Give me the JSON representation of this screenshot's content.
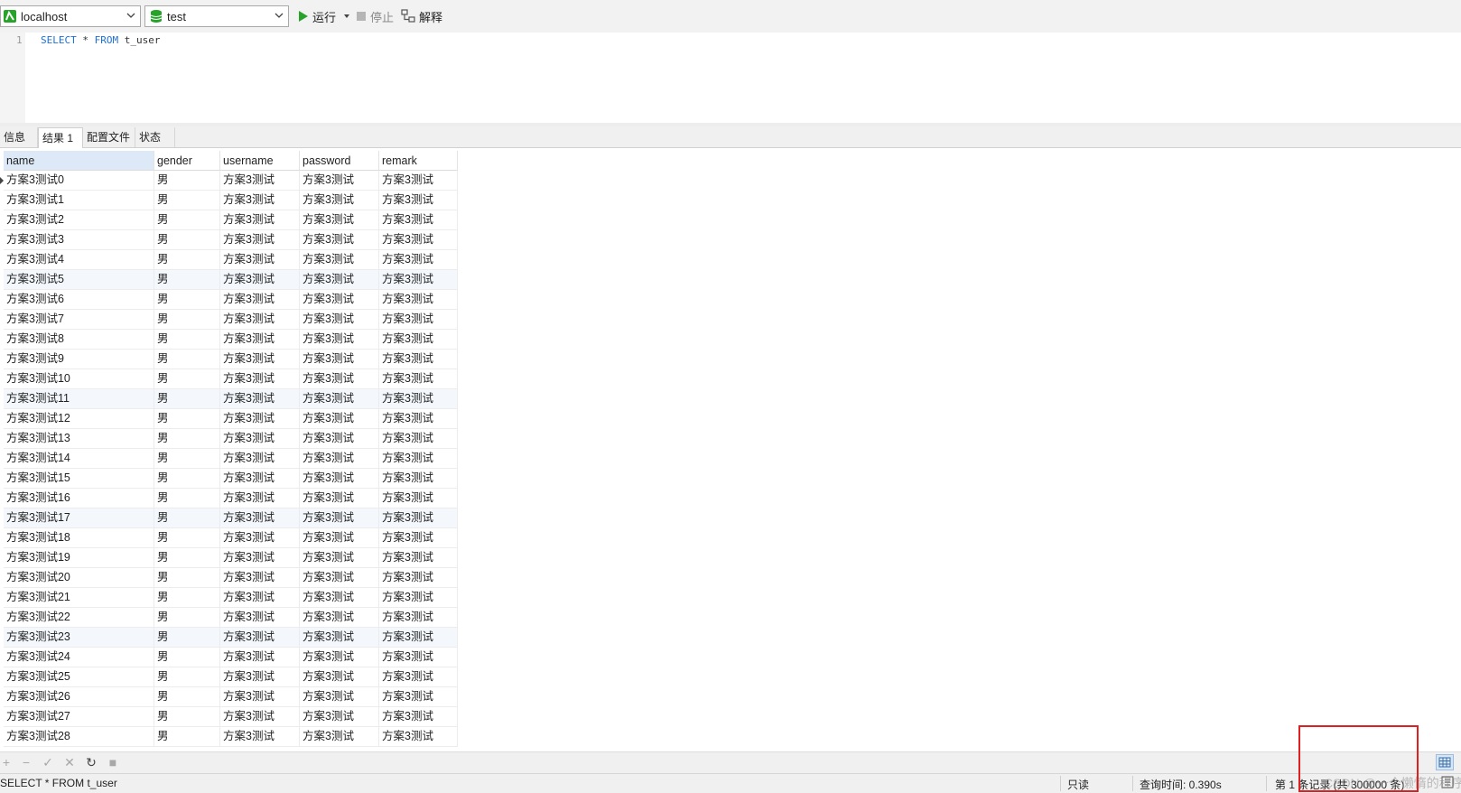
{
  "toolbar": {
    "connection": "localhost",
    "database": "test",
    "run_label": "运行",
    "stop_label": "停止",
    "explain_label": "解释"
  },
  "editor": {
    "line_number": "1",
    "keyword_select": "SELECT",
    "star": " * ",
    "keyword_from": "FROM",
    "table": " t_user"
  },
  "tabs": [
    "信息",
    "结果 1",
    "配置文件",
    "状态"
  ],
  "grid": {
    "columns": [
      "name",
      "gender",
      "username",
      "password",
      "remark"
    ],
    "rows": [
      [
        "方案3测试0",
        "男",
        "方案3测试",
        "方案3测试",
        "方案3测试"
      ],
      [
        "方案3测试1",
        "男",
        "方案3测试",
        "方案3测试",
        "方案3测试"
      ],
      [
        "方案3测试2",
        "男",
        "方案3测试",
        "方案3测试",
        "方案3测试"
      ],
      [
        "方案3测试3",
        "男",
        "方案3测试",
        "方案3测试",
        "方案3测试"
      ],
      [
        "方案3测试4",
        "男",
        "方案3测试",
        "方案3测试",
        "方案3测试"
      ],
      [
        "方案3测试5",
        "男",
        "方案3测试",
        "方案3测试",
        "方案3测试"
      ],
      [
        "方案3测试6",
        "男",
        "方案3测试",
        "方案3测试",
        "方案3测试"
      ],
      [
        "方案3测试7",
        "男",
        "方案3测试",
        "方案3测试",
        "方案3测试"
      ],
      [
        "方案3测试8",
        "男",
        "方案3测试",
        "方案3测试",
        "方案3测试"
      ],
      [
        "方案3测试9",
        "男",
        "方案3测试",
        "方案3测试",
        "方案3测试"
      ],
      [
        "方案3测试10",
        "男",
        "方案3测试",
        "方案3测试",
        "方案3测试"
      ],
      [
        "方案3测试11",
        "男",
        "方案3测试",
        "方案3测试",
        "方案3测试"
      ],
      [
        "方案3测试12",
        "男",
        "方案3测试",
        "方案3测试",
        "方案3测试"
      ],
      [
        "方案3测试13",
        "男",
        "方案3测试",
        "方案3测试",
        "方案3测试"
      ],
      [
        "方案3测试14",
        "男",
        "方案3测试",
        "方案3测试",
        "方案3测试"
      ],
      [
        "方案3测试15",
        "男",
        "方案3测试",
        "方案3测试",
        "方案3测试"
      ],
      [
        "方案3测试16",
        "男",
        "方案3测试",
        "方案3测试",
        "方案3测试"
      ],
      [
        "方案3测试17",
        "男",
        "方案3测试",
        "方案3测试",
        "方案3测试"
      ],
      [
        "方案3测试18",
        "男",
        "方案3测试",
        "方案3测试",
        "方案3测试"
      ],
      [
        "方案3测试19",
        "男",
        "方案3测试",
        "方案3测试",
        "方案3测试"
      ],
      [
        "方案3测试20",
        "男",
        "方案3测试",
        "方案3测试",
        "方案3测试"
      ],
      [
        "方案3测试21",
        "男",
        "方案3测试",
        "方案3测试",
        "方案3测试"
      ],
      [
        "方案3测试22",
        "男",
        "方案3测试",
        "方案3测试",
        "方案3测试"
      ],
      [
        "方案3测试23",
        "男",
        "方案3测试",
        "方案3测试",
        "方案3测试"
      ],
      [
        "方案3测试24",
        "男",
        "方案3测试",
        "方案3测试",
        "方案3测试"
      ],
      [
        "方案3测试25",
        "男",
        "方案3测试",
        "方案3测试",
        "方案3测试"
      ],
      [
        "方案3测试26",
        "男",
        "方案3测试",
        "方案3测试",
        "方案3测试"
      ],
      [
        "方案3测试27",
        "男",
        "方案3测试",
        "方案3测试",
        "方案3测试"
      ],
      [
        "方案3测试28",
        "男",
        "方案3测试",
        "方案3测试",
        "方案3测试"
      ]
    ]
  },
  "status": {
    "query": "SELECT * FROM t_user",
    "readonly": "只读",
    "query_time": "查询时间: 0.390s",
    "records": "第 1 条记录 (共 300000 条)",
    "watermark": "CSDN @一个懒惰的程序员"
  },
  "icons": {
    "connection": "connection-icon",
    "database": "database-icon",
    "run": "play-icon",
    "stop": "stop-icon",
    "explain": "explain-icon"
  },
  "colors": {
    "keyword": "#1f6fd0",
    "run_green": "#27a32a",
    "highlight_red": "#e02020",
    "header_selected": "#dde9f7"
  }
}
